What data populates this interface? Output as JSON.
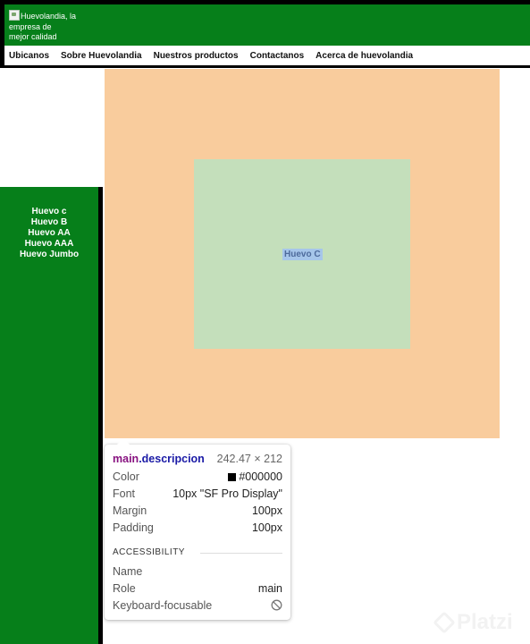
{
  "header": {
    "logo_alt": "Huevolandia, la\nempresa de\nmejor calidad",
    "nav": [
      "Ubicanos",
      "Sobre Huevolandia",
      "Nuestros productos",
      "Contactanos",
      "Acerca de huevolandia"
    ]
  },
  "aside": {
    "items": [
      "Huevo c",
      "Huevo B",
      "Huevo AA",
      "Huevo AAA",
      "Huevo Jumbo"
    ]
  },
  "main": {
    "content_text": "Huevo C"
  },
  "inspector": {
    "tag": "main",
    "class": ".descripcion",
    "size": "242.47 × 212",
    "rows": [
      {
        "key": "Color",
        "value": "#000000"
      },
      {
        "key": "Font",
        "value": "10px \"SF Pro Display\""
      },
      {
        "key": "Margin",
        "value": "100px"
      },
      {
        "key": "Padding",
        "value": "100px"
      }
    ],
    "accessibility_title": "ACCESSIBILITY",
    "accessibility": [
      {
        "key": "Name",
        "value": ""
      },
      {
        "key": "Role",
        "value": "main"
      },
      {
        "key": "Keyboard-focusable",
        "icon": "no-entry-icon"
      }
    ]
  },
  "colors": {
    "header_green": "#067f1a",
    "margin_overlay": "#f9cc9d",
    "padding_overlay": "#c4dfbb",
    "content_highlight": "#a6c6ea"
  },
  "watermark": "Platzi"
}
